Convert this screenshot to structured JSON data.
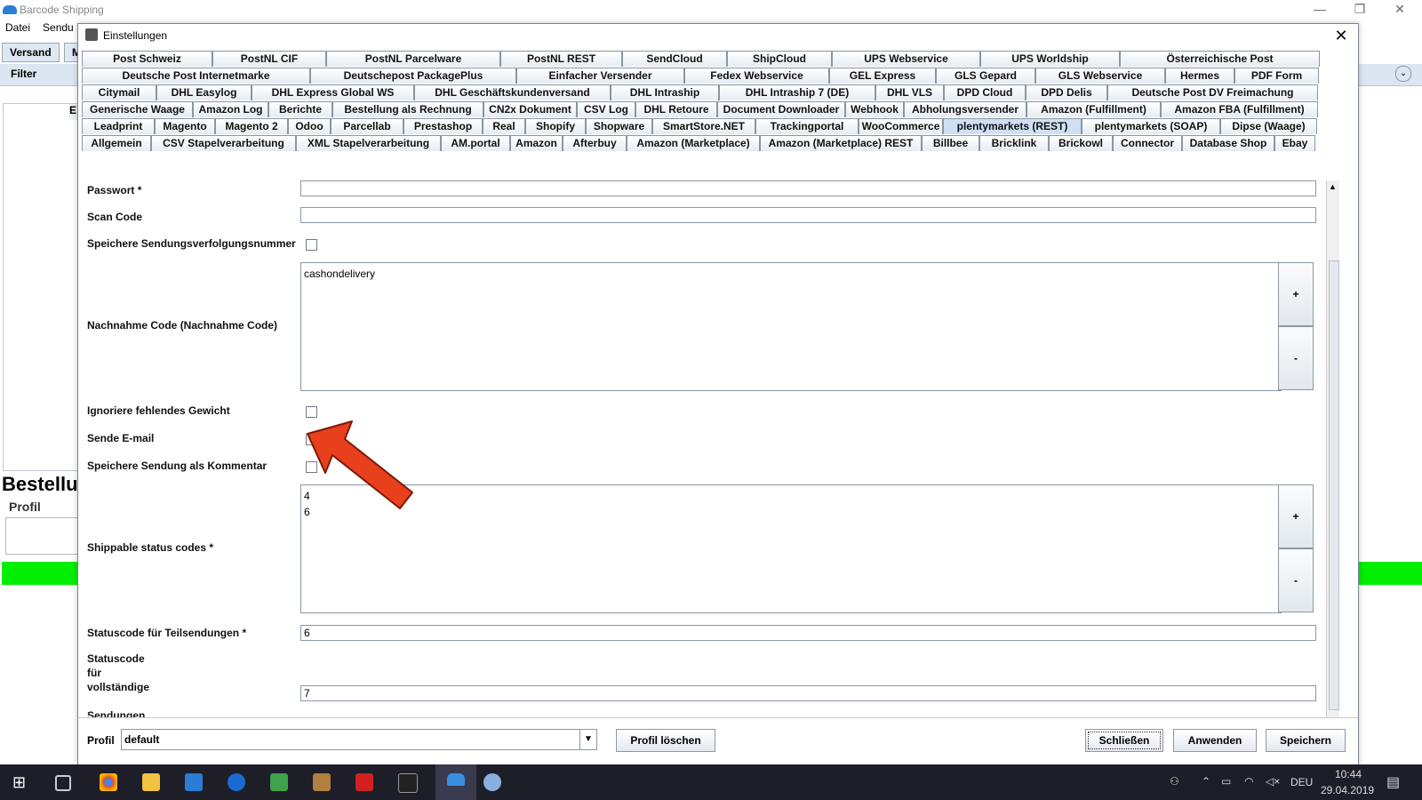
{
  "app": {
    "title": "Barcode Shipping",
    "menu": [
      "Datei",
      "Sendu"
    ],
    "tabs": [
      "Versand",
      "M"
    ],
    "filter_label": "Filter",
    "panel_letter": "E",
    "bestell_label": "Bestellu",
    "profil_label": "Profil"
  },
  "dialog": {
    "title": "Einstellungen",
    "close": "✕",
    "tab_rows": [
      [
        "Post Schweiz",
        "PostNL CIF",
        "PostNL Parcelware",
        "PostNL REST",
        "SendCloud",
        "ShipCloud",
        "UPS Webservice",
        "UPS Worldship",
        "Österreichische Post"
      ],
      [
        "Deutsche Post Internetmarke",
        "Deutschepost PackagePlus",
        "Einfacher Versender",
        "Fedex Webservice",
        "GEL Express",
        "GLS Gepard",
        "GLS Webservice",
        "Hermes",
        "PDF Form"
      ],
      [
        "Citymail",
        "DHL Easylog",
        "DHL Express Global WS",
        "DHL Geschäftskundenversand",
        "DHL Intraship",
        "DHL Intraship 7 (DE)",
        "DHL VLS",
        "DPD Cloud",
        "DPD Delis",
        "Deutsche Post DV Freimachung"
      ],
      [
        "Generische Waage",
        "Amazon Log",
        "Berichte",
        "Bestellung als Rechnung",
        "CN2x Dokument",
        "CSV Log",
        "DHL Retoure",
        "Document Downloader",
        "Webhook",
        "Abholungsversender",
        "Amazon (Fulfillment)",
        "Amazon FBA (Fulfillment)"
      ],
      [
        "Leadprint",
        "Magento",
        "Magento 2",
        "Odoo",
        "Parcellab",
        "Prestashop",
        "Real",
        "Shopify",
        "Shopware",
        "SmartStore.NET",
        "Trackingportal",
        "WooCommerce",
        "plentymarkets (REST)",
        "plentymarkets (SOAP)",
        "Dipse (Waage)"
      ],
      [
        "Allgemein",
        "CSV Stapelverarbeitung",
        "XML Stapelverarbeitung",
        "AM.portal",
        "Amazon",
        "Afterbuy",
        "Amazon (Marketplace)",
        "Amazon (Marketplace) REST",
        "Billbee",
        "Bricklink",
        "Brickowl",
        "Connector",
        "Database Shop",
        "Ebay"
      ]
    ],
    "selected_tab": "plentymarkets (REST)",
    "form": {
      "passwort_label": "Passwort *",
      "passwort_value": "",
      "scan_code_label": "Scan Code",
      "scan_code_value": "",
      "speichere_tracking_label": "Speichere Sendungsverfolgungsnummer",
      "nachnahme_label": "Nachnahme Code (Nachnahme Code)",
      "nachnahme_value": "cashondelivery",
      "ignoriere_label": "Ignoriere fehlendes Gewicht",
      "sende_email_label": "Sende E-mail",
      "kommentar_label": "Speichere Sendung als Kommentar",
      "shippable_label": "Shippable status codes *",
      "shippable_values": [
        "4",
        "6"
      ],
      "teil_label": "Statuscode für Teilsendungen *",
      "teil_value": "6",
      "voll_label_lines": [
        "Statuscode",
        "für",
        "vollständige",
        "Sendungen",
        "*"
      ],
      "voll_value": "7",
      "plus": "+",
      "minus": "-"
    },
    "bottom": {
      "profil_label": "Profil",
      "profil_value": "default",
      "profil_loeschen": "Profil löschen",
      "schliessen": "Schließen",
      "anwenden": "Anwenden",
      "speichern": "Speichern"
    }
  },
  "taskbar": {
    "lang": "DEU",
    "time": "10:44",
    "date": "29.04.2019"
  },
  "colors": {
    "arrow": "#e8401c",
    "green_status": "#00ee00",
    "selected_tab": "#cfe0f4"
  }
}
